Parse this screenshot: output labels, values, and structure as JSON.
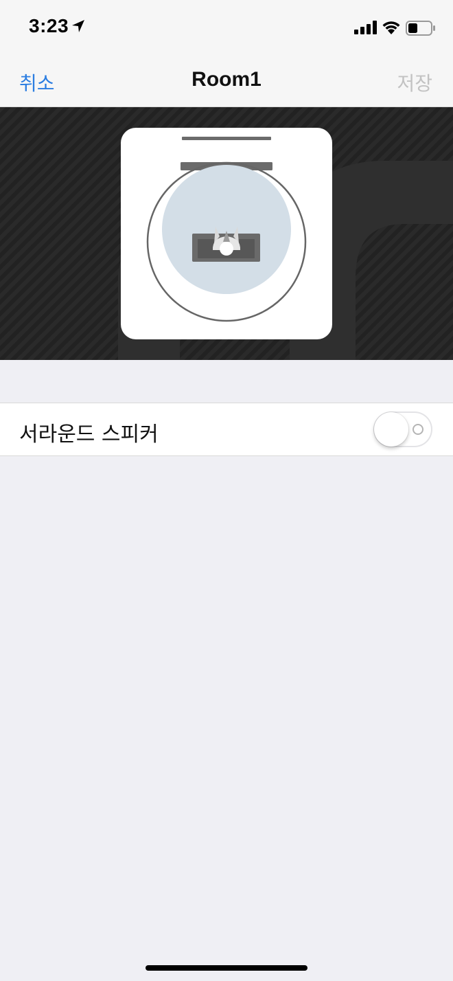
{
  "status_bar": {
    "time": "3:23",
    "icons": [
      "location-arrow-icon",
      "cellular-signal-icon",
      "wifi-icon",
      "battery-icon"
    ],
    "battery_level": 0.35
  },
  "nav": {
    "cancel_label": "취소",
    "title": "Room1",
    "save_label": "저장"
  },
  "hero": {
    "illustration": "room-speaker-layout",
    "colors": {
      "background": "#262626",
      "card": "#ffffff",
      "listening_zone": "#d3dee7",
      "speaker_bar": "#666666"
    }
  },
  "settings": {
    "rows": [
      {
        "label": "서라운드 스피커",
        "toggle_on": false
      }
    ]
  },
  "colors": {
    "accent": "#2b7de1",
    "disabled": "#c2c2c2",
    "background": "#efeff4"
  }
}
